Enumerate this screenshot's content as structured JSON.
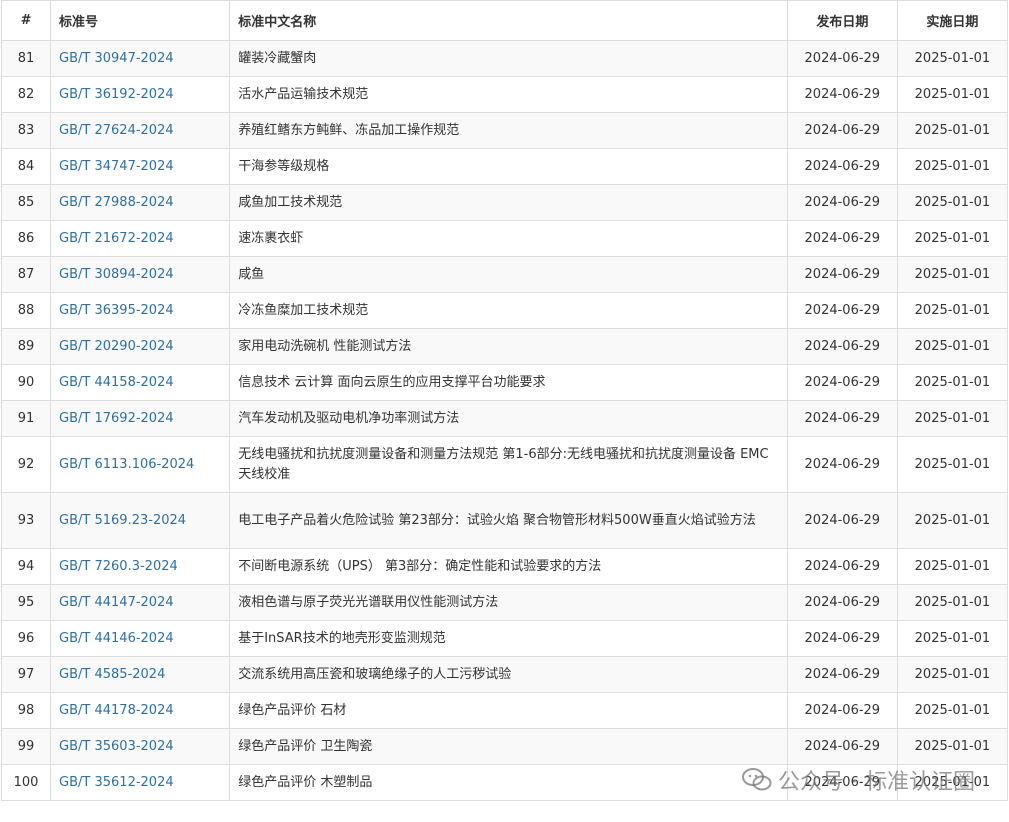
{
  "header": {
    "num": "#",
    "code": "标准号",
    "name": "标准中文名称",
    "published": "发布日期",
    "implemented": "实施日期"
  },
  "rows": [
    {
      "num": "81",
      "code": "GB/T 30947-2024",
      "name": "罐装冷藏蟹肉",
      "published": "2024-06-29",
      "implemented": "2025-01-01"
    },
    {
      "num": "82",
      "code": "GB/T 36192-2024",
      "name": "活水产品运输技术规范",
      "published": "2024-06-29",
      "implemented": "2025-01-01"
    },
    {
      "num": "83",
      "code": "GB/T 27624-2024",
      "name": "养殖红鳍东方鲀鲜、冻品加工操作规范",
      "published": "2024-06-29",
      "implemented": "2025-01-01"
    },
    {
      "num": "84",
      "code": "GB/T 34747-2024",
      "name": "干海参等级规格",
      "published": "2024-06-29",
      "implemented": "2025-01-01"
    },
    {
      "num": "85",
      "code": "GB/T 27988-2024",
      "name": "咸鱼加工技术规范",
      "published": "2024-06-29",
      "implemented": "2025-01-01"
    },
    {
      "num": "86",
      "code": "GB/T 21672-2024",
      "name": "速冻裹衣虾",
      "published": "2024-06-29",
      "implemented": "2025-01-01"
    },
    {
      "num": "87",
      "code": "GB/T 30894-2024",
      "name": "咸鱼",
      "published": "2024-06-29",
      "implemented": "2025-01-01"
    },
    {
      "num": "88",
      "code": "GB/T 36395-2024",
      "name": "冷冻鱼糜加工技术规范",
      "published": "2024-06-29",
      "implemented": "2025-01-01"
    },
    {
      "num": "89",
      "code": "GB/T 20290-2024",
      "name": "家用电动洗碗机 性能测试方法",
      "published": "2024-06-29",
      "implemented": "2025-01-01"
    },
    {
      "num": "90",
      "code": "GB/T 44158-2024",
      "name": "信息技术 云计算 面向云原生的应用支撑平台功能要求",
      "published": "2024-06-29",
      "implemented": "2025-01-01"
    },
    {
      "num": "91",
      "code": "GB/T 17692-2024",
      "name": "汽车发动机及驱动电机净功率测试方法",
      "published": "2024-06-29",
      "implemented": "2025-01-01"
    },
    {
      "num": "92",
      "code": "GB/T 6113.106-2024",
      "name": "无线电骚扰和抗扰度测量设备和测量方法规范 第1-6部分:无线电骚扰和抗扰度测量设备 EMC天线校准",
      "published": "2024-06-29",
      "implemented": "2025-01-01",
      "tall": true
    },
    {
      "num": "93",
      "code": "GB/T 5169.23-2024",
      "name": "电工电子产品着火危险试验 第23部分：试验火焰 聚合物管形材料500W垂直火焰试验方法",
      "published": "2024-06-29",
      "implemented": "2025-01-01",
      "tall": true
    },
    {
      "num": "94",
      "code": "GB/T 7260.3-2024",
      "name": "不间断电源系统（UPS） 第3部分：确定性能和试验要求的方法",
      "published": "2024-06-29",
      "implemented": "2025-01-01"
    },
    {
      "num": "95",
      "code": "GB/T 44147-2024",
      "name": "液相色谱与原子荧光光谱联用仪性能测试方法",
      "published": "2024-06-29",
      "implemented": "2025-01-01"
    },
    {
      "num": "96",
      "code": "GB/T 44146-2024",
      "name": "基于InSAR技术的地壳形变监测规范",
      "published": "2024-06-29",
      "implemented": "2025-01-01"
    },
    {
      "num": "97",
      "code": "GB/T 4585-2024",
      "name": "交流系统用高压瓷和玻璃绝缘子的人工污秽试验",
      "published": "2024-06-29",
      "implemented": "2025-01-01"
    },
    {
      "num": "98",
      "code": "GB/T 44178-2024",
      "name": "绿色产品评价 石材",
      "published": "2024-06-29",
      "implemented": "2025-01-01"
    },
    {
      "num": "99",
      "code": "GB/T 35603-2024",
      "name": "绿色产品评价 卫生陶瓷",
      "published": "2024-06-29",
      "implemented": "2025-01-01"
    },
    {
      "num": "100",
      "code": "GB/T 35612-2024",
      "name": "绿色产品评价 木塑制品",
      "published": "2024-06-29",
      "implemented": "2025-01-01"
    }
  ],
  "watermark": {
    "text": "公众号 · 标准认证圈",
    "icon": "wechat-icon"
  },
  "colors": {
    "link": "#2f6fa5",
    "border": "#dddddd",
    "stripe": "#f9f9f9"
  }
}
